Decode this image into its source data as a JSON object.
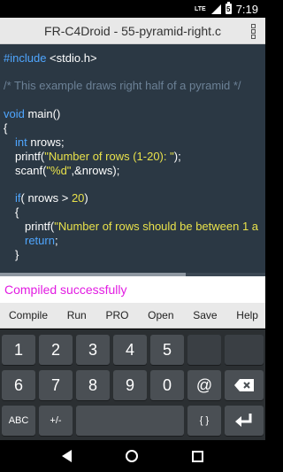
{
  "statusbar": {
    "network": "LTE",
    "battery_level": "5",
    "time": "7:19"
  },
  "titlebar": {
    "title": "FR-C4Droid - 55-pyramid-right.c",
    "menu_icon": "vertical-dots"
  },
  "editor": {
    "line1": {
      "kw": "#include",
      "txt": " <stdio.h>"
    },
    "line2": {
      "cm": "/* This example draws right half of a pyramid */"
    },
    "line3": {
      "kw": "void",
      "txt": " main()"
    },
    "line4": {
      "txt": "{"
    },
    "line5": {
      "kw": "int",
      "txt": " nrows;"
    },
    "line6": {
      "txt_a": "printf(",
      "str": "\"Number of rows (1-20): \"",
      "txt_b": ");"
    },
    "line7": {
      "txt_a": "scanf(",
      "str": "\"%d\"",
      "txt_b": ",&nrows);"
    },
    "line8": {
      "kw": "if",
      "txt": "( nrows > ",
      "num": "20",
      "txt_b": ")"
    },
    "line9": {
      "txt": "{"
    },
    "line10": {
      "txt_a": "printf(",
      "str": "\"Number of rows should be between 1 a"
    },
    "line11": {
      "kw": "return",
      "txt": ";"
    },
    "line12": {
      "txt": "}"
    }
  },
  "status": {
    "message": "Compiled successfully"
  },
  "toolbar": {
    "compile": "Compile",
    "run": "Run",
    "pro": "PRO",
    "open": "Open",
    "save": "Save",
    "help": "Help"
  },
  "keyboard": {
    "row1": [
      "1",
      "2",
      "3",
      "4",
      "5"
    ],
    "row2": [
      "6",
      "7",
      "8",
      "9",
      "0",
      "@"
    ],
    "row3": {
      "abc": "ABC",
      "plusminus": "+/-",
      "braces": "{ }"
    }
  },
  "colors": {
    "editor_bg": "#2b3844",
    "keyword": "#4fa6ff",
    "string": "#e8e14b",
    "comment": "#6c8196",
    "status_text": "#e21be2"
  }
}
